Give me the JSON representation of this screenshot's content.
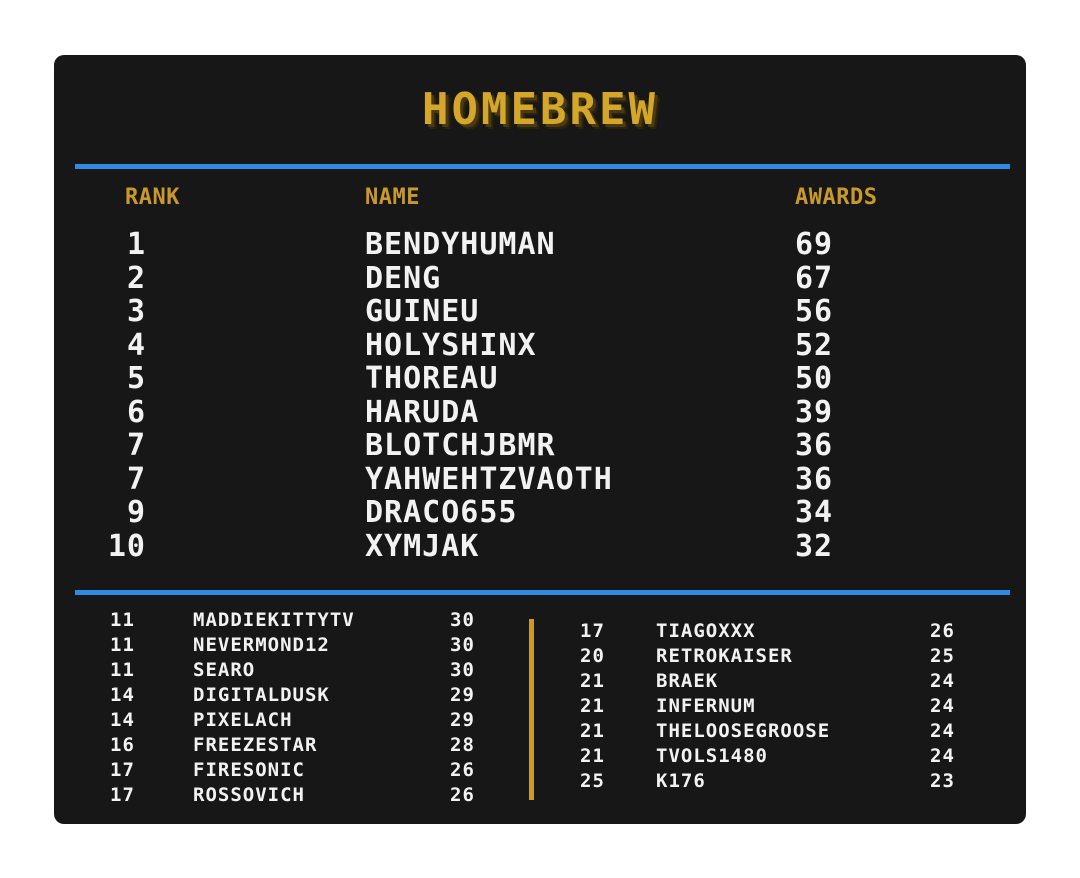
{
  "title": "HOMEBREW",
  "colors": {
    "background": "#171717",
    "title": "#d4a62a",
    "header": "#c9992c",
    "divider": "#2f8ae6",
    "text": "#f2f2f2"
  },
  "headers": {
    "rank": "RANK",
    "name": "NAME",
    "awards": "AWARDS"
  },
  "top10": [
    {
      "rank": "1",
      "name": "BENDYHUMAN",
      "awards": "69"
    },
    {
      "rank": "2",
      "name": "DENG",
      "awards": "67"
    },
    {
      "rank": "3",
      "name": "GUINEU",
      "awards": "56"
    },
    {
      "rank": "4",
      "name": "HOLYSHINX",
      "awards": "52"
    },
    {
      "rank": "5",
      "name": "THOREAU",
      "awards": "50"
    },
    {
      "rank": "6",
      "name": "HARUDA",
      "awards": "39"
    },
    {
      "rank": "7",
      "name": "BLOTCHJBMR",
      "awards": "36"
    },
    {
      "rank": "7",
      "name": "YAHWEHTZVAOTH",
      "awards": "36"
    },
    {
      "rank": "9",
      "name": "DRACO655",
      "awards": "34"
    },
    {
      "rank": "10",
      "name": "XYMJAK",
      "awards": "32"
    }
  ],
  "left_list": [
    {
      "rank": "11",
      "name": "MADDIEKITTYTV",
      "awards": "30"
    },
    {
      "rank": "11",
      "name": "NEVERMOND12",
      "awards": "30"
    },
    {
      "rank": "11",
      "name": "SEARO",
      "awards": "30"
    },
    {
      "rank": "14",
      "name": "DIGITALDUSK",
      "awards": "29"
    },
    {
      "rank": "14",
      "name": "PIXELACH",
      "awards": "29"
    },
    {
      "rank": "16",
      "name": "FREEZESTAR",
      "awards": "28"
    },
    {
      "rank": "17",
      "name": "FIRESONIC",
      "awards": "26"
    },
    {
      "rank": "17",
      "name": "ROSSOVICH",
      "awards": "26"
    }
  ],
  "right_list": [
    {
      "rank": "17",
      "name": "TIAGOXXX",
      "awards": "26"
    },
    {
      "rank": "20",
      "name": "RETROKAISER",
      "awards": "25"
    },
    {
      "rank": "21",
      "name": "BRAEK",
      "awards": "24"
    },
    {
      "rank": "21",
      "name": "INFERNUM",
      "awards": "24"
    },
    {
      "rank": "21",
      "name": "THELOOSEGROOSE",
      "awards": "24"
    },
    {
      "rank": "21",
      "name": "TVOLS1480",
      "awards": "24"
    },
    {
      "rank": "25",
      "name": "K176",
      "awards": "23"
    }
  ]
}
